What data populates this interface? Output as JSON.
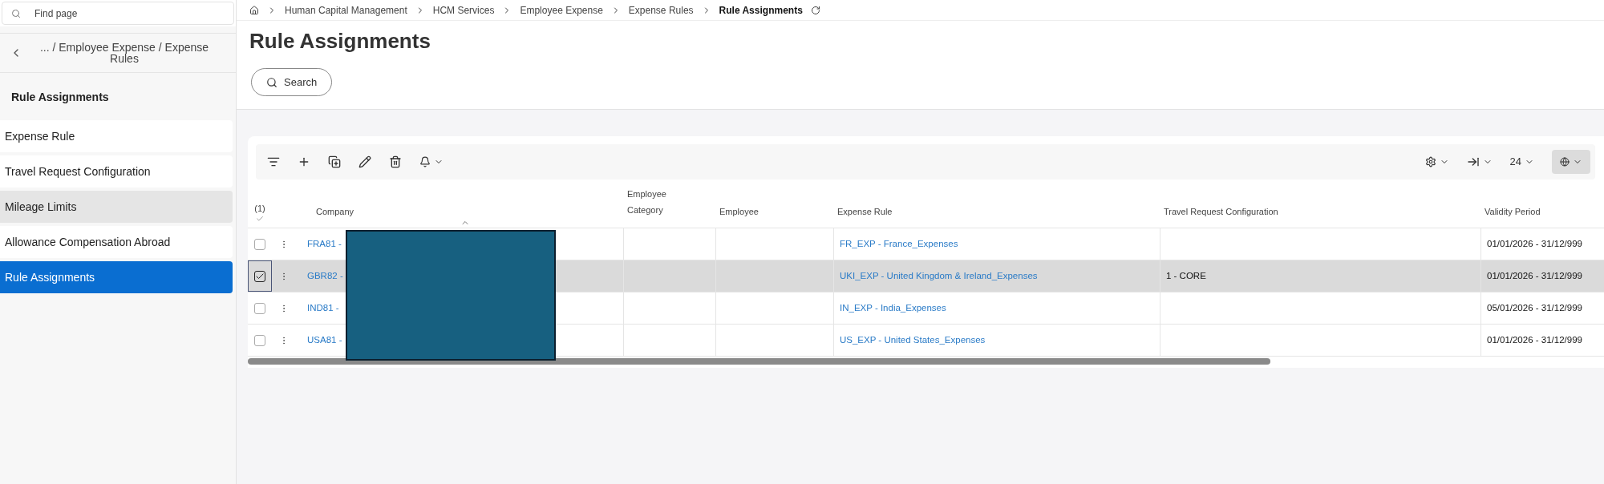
{
  "sidebar": {
    "search": {
      "placeholder": "Find page"
    },
    "path": "... / Employee Expense / Expense Rules",
    "title": "Rule Assignments",
    "items": [
      {
        "label": "Expense Rule",
        "selected": false,
        "highlighted": false
      },
      {
        "label": "Travel Request Configuration",
        "selected": false,
        "highlighted": false
      },
      {
        "label": "Mileage Limits",
        "selected": false,
        "highlighted": true
      },
      {
        "label": "Allowance Compensation Abroad",
        "selected": false,
        "highlighted": false
      },
      {
        "label": "Rule Assignments",
        "selected": true,
        "highlighted": false
      }
    ]
  },
  "breadcrumb": [
    "Human Capital Management",
    "HCM Services",
    "Employee Expense",
    "Expense Rules",
    "Rule Assignments"
  ],
  "page": {
    "title": "Rule Assignments",
    "search_button": "Search"
  },
  "toolbar": {
    "page_size": "24"
  },
  "table": {
    "selected_count": "(1)",
    "columns": [
      "Company",
      "Employee Category",
      "Employee",
      "Expense Rule",
      "Travel Request Configuration",
      "Validity Period"
    ],
    "rows": [
      {
        "company": "FRA81 -",
        "expense_rule": "FR_EXP - France_Expenses",
        "travel_request_configuration": "",
        "validity_period": "01/01/2026 - 31/12/999",
        "selected": false
      },
      {
        "company": "GBR82 -",
        "expense_rule": "UKI_EXP - United Kingdom & Ireland_Expenses",
        "travel_request_configuration": "1 - CORE",
        "validity_period": "01/01/2026 - 31/12/999",
        "selected": true
      },
      {
        "company": "IND81 -",
        "expense_rule": "IN_EXP - India_Expenses",
        "travel_request_configuration": "",
        "validity_period": "05/01/2026 - 31/12/999",
        "selected": false
      },
      {
        "company": "USA81 -",
        "expense_rule": "US_EXP - United States_Expenses",
        "travel_request_configuration": "",
        "validity_period": "01/01/2026 - 31/12/999",
        "selected": false
      }
    ]
  }
}
